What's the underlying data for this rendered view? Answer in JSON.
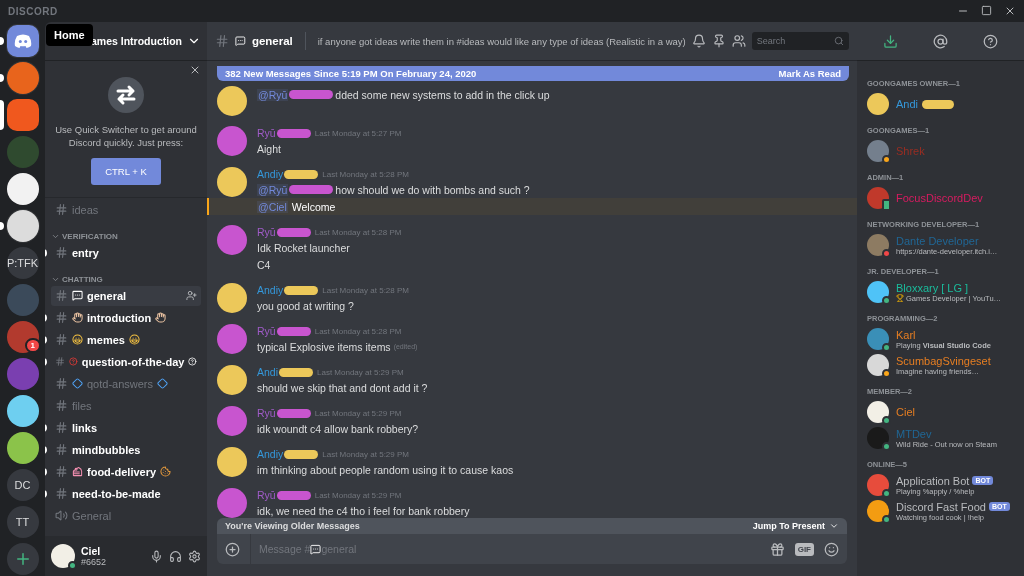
{
  "app_title": "DISCORD",
  "tooltip": "Home",
  "servers": [
    {
      "kind": "home",
      "selected": false,
      "unread": true
    },
    {
      "kind": "image",
      "color": "#e8641c",
      "selected": false,
      "unread": true
    },
    {
      "kind": "image",
      "color": "#f0581e",
      "selected": true,
      "unread": false
    },
    {
      "kind": "image",
      "color": "#2f4a2f",
      "selected": false,
      "unread": false
    },
    {
      "kind": "image",
      "color": "#f2f2f2",
      "selected": false,
      "unread": false
    },
    {
      "kind": "image",
      "color": "#dcdcdc",
      "selected": false,
      "unread": true
    },
    {
      "kind": "text",
      "label": "P:TFK",
      "selected": false,
      "unread": false
    },
    {
      "kind": "image",
      "color": "#3b4a5a",
      "selected": false,
      "unread": false
    },
    {
      "kind": "image",
      "color": "#b23a2e",
      "selected": false,
      "unread": false,
      "badge": "1"
    },
    {
      "kind": "image",
      "color": "#7a3fb0",
      "selected": false,
      "unread": false
    },
    {
      "kind": "image",
      "color": "#6ecff0",
      "selected": false,
      "unread": false
    },
    {
      "kind": "image",
      "color": "#8bc34a",
      "selected": false,
      "unread": false
    },
    {
      "kind": "text",
      "label": "DC",
      "selected": false,
      "unread": false
    },
    {
      "kind": "text",
      "label": "TT",
      "selected": false,
      "unread": false
    },
    {
      "kind": "add"
    }
  ],
  "server_name": "ames Introduction",
  "quick_switcher": {
    "text": "Use Quick Switcher to get around Discord quickly. Just press:",
    "button": "CTRL + K"
  },
  "channel_sections": [
    {
      "channels": [
        {
          "name": "ideas",
          "kind": "text",
          "unread": false,
          "selected": false
        }
      ]
    },
    {
      "category": "VERIFICATION",
      "expanded": true,
      "channels": [
        {
          "name": "entry",
          "kind": "text",
          "unread": true,
          "selected": false
        }
      ]
    },
    {
      "category": "CHATTING",
      "expanded": true,
      "channels": [
        {
          "name": "general",
          "kind": "text",
          "unread": false,
          "selected": true,
          "before": {
            "kind": "speech"
          }
        },
        {
          "name": "introduction",
          "kind": "text",
          "unread": true,
          "selected": false,
          "before": {
            "kind": "wave"
          },
          "after": {
            "kind": "wave"
          }
        },
        {
          "name": "memes",
          "kind": "text",
          "unread": true,
          "selected": false,
          "before": {
            "kind": "laugh"
          },
          "after": {
            "kind": "laugh"
          }
        },
        {
          "name": "question-of-the-day",
          "kind": "text",
          "unread": true,
          "selected": false,
          "before": {
            "kind": "question"
          },
          "after": {
            "kind": "question-outline"
          }
        },
        {
          "name": "qotd-answers",
          "kind": "text",
          "unread": false,
          "selected": false,
          "before": {
            "kind": "diamond"
          },
          "after": {
            "kind": "diamond"
          }
        },
        {
          "name": "files",
          "kind": "text",
          "unread": false,
          "selected": false
        },
        {
          "name": "links",
          "kind": "text",
          "unread": true,
          "selected": false
        },
        {
          "name": "mindbubbles",
          "kind": "text",
          "unread": true,
          "selected": false
        },
        {
          "name": "food-delivery",
          "kind": "text",
          "unread": true,
          "selected": false,
          "before": {
            "kind": "cupcake"
          },
          "after": {
            "kind": "donut"
          }
        },
        {
          "name": "need-to-be-made",
          "kind": "text",
          "unread": true,
          "selected": false
        },
        {
          "name": "General",
          "kind": "voice",
          "unread": false,
          "selected": false
        }
      ]
    }
  ],
  "user": {
    "name": "Ciel",
    "tag": "#6652"
  },
  "chat": {
    "channel": "general",
    "topic": "if anyone got ideas write them in #ideas would like any type of ideas (Realistic in a way)",
    "search_placeholder": "Search"
  },
  "new_messages": {
    "text": "382 New Messages Since 5:19 PM On February 24, 2020",
    "action": "Mark As Read"
  },
  "messages": [
    {
      "avatar": {
        "color": "#ecc85a"
      },
      "lines": [
        {
          "mention": "@Ryū",
          "redacted": true,
          "text": "dded some new systems to add in the click up",
          "highlighted": false
        }
      ]
    },
    {
      "author": {
        "name": "Ryū",
        "color": "#a05bc8"
      },
      "avatar": {
        "color": "#c855cf"
      },
      "timestamp": "Last Monday at 5:27 PM",
      "lines": [
        {
          "text": "Aight",
          "highlighted": false
        }
      ]
    },
    {
      "author": {
        "name": "Andiy",
        "color": "#3498db"
      },
      "avatar": {
        "color": "#ecc85a"
      },
      "timestamp": "Last Monday at 5:28 PM",
      "lines": [
        {
          "mention": "@Ryū",
          "redacted": true,
          "text": "how should we do with bombs and such ?",
          "highlighted": false
        },
        {
          "mention": "@Ciel",
          "redacted": false,
          "text": "Welcome",
          "highlighted": true
        }
      ]
    },
    {
      "author": {
        "name": "Ryū",
        "color": "#a05bc8"
      },
      "avatar": {
        "color": "#c855cf"
      },
      "timestamp": "Last Monday at 5:28 PM",
      "lines": [
        {
          "text": "Idk Rocket launcher",
          "highlighted": false
        },
        {
          "text": "C4",
          "highlighted": false
        }
      ]
    },
    {
      "author": {
        "name": "Andiy",
        "color": "#3498db"
      },
      "avatar": {
        "color": "#ecc85a"
      },
      "timestamp": "Last Monday at 5:28 PM",
      "lines": [
        {
          "text": "you good at writing ?",
          "highlighted": false
        }
      ]
    },
    {
      "author": {
        "name": "Ryū",
        "color": "#a05bc8"
      },
      "avatar": {
        "color": "#c855cf"
      },
      "timestamp": "Last Monday at 5:28 PM",
      "lines": [
        {
          "text": "typical Explosive items items",
          "edited": "(edited)",
          "highlighted": false
        }
      ]
    },
    {
      "author": {
        "name": "Andi",
        "color": "#3498db"
      },
      "avatar": {
        "color": "#ecc85a"
      },
      "timestamp": "Last Monday at 5:29 PM",
      "lines": [
        {
          "text": "should we skip that and dont add it ?",
          "highlighted": false
        }
      ]
    },
    {
      "author": {
        "name": "Ryū",
        "color": "#a05bc8"
      },
      "avatar": {
        "color": "#c855cf"
      },
      "timestamp": "Last Monday at 5:29 PM",
      "lines": [
        {
          "text": "idk woundt c4 allow bank robbery?",
          "highlighted": false
        }
      ]
    },
    {
      "author": {
        "name": "Andiy",
        "color": "#3498db"
      },
      "avatar": {
        "color": "#ecc85a"
      },
      "timestamp": "Last Monday at 5:29 PM",
      "lines": [
        {
          "text": "im thinking about people random using it to cause kaos",
          "highlighted": false
        }
      ]
    },
    {
      "author": {
        "name": "Ryū",
        "color": "#a05bc8"
      },
      "avatar": {
        "color": "#c855cf"
      },
      "timestamp": "Last Monday at 5:29 PM",
      "lines": [
        {
          "text": "idk, we need the c4 tho i feel for bank robbery",
          "highlighted": false
        }
      ]
    }
  ],
  "older_bar": {
    "text": "You're Viewing Older Messages",
    "action": "Jump To Present"
  },
  "composer": {
    "placeholder_prefix": "Message #",
    "placeholder_channel": "general",
    "gif": "GIF"
  },
  "member_groups": [
    {
      "title": "GOONGAMES OWNER—1",
      "members": [
        {
          "name": "Andi",
          "redacted": true,
          "color": "#3498db",
          "avatar": {
            "color": "#ecc85a"
          }
        }
      ]
    },
    {
      "title": "GOONGAMES—1",
      "members": [
        {
          "name": "Shrek",
          "color": "#992d22",
          "avatar": {
            "color": "#747f8d"
          },
          "status": {
            "kind": "idle"
          }
        }
      ]
    },
    {
      "title": "ADMIN—1",
      "members": [
        {
          "name": "FocusDiscordDev",
          "color": "#d81b60",
          "avatar": {
            "color": "#c0392b"
          },
          "status": {
            "kind": "mobile"
          }
        }
      ]
    },
    {
      "title": "NETWORKING DEVELOPER—1",
      "members": [
        {
          "name": "Dante Developer",
          "color": "#206694",
          "avatar": {
            "color": "#8d7b62"
          },
          "status": {
            "kind": "dnd"
          },
          "activity": "https://dante-developer.itch.i…"
        }
      ]
    },
    {
      "title": "JR. DEVELOPER—1",
      "members": [
        {
          "name": "Bloxxary [ LG ]",
          "color": "#1abc9c",
          "avatar": {
            "color": "#4fc3f7"
          },
          "status": {
            "kind": "online"
          },
          "activity": "Games Developer | YouTu…",
          "activity_icon": {
            "kind": "trophy"
          }
        }
      ]
    },
    {
      "title": "PROGRAMMING—2",
      "members": [
        {
          "name": "Karl",
          "color": "#e67e22",
          "avatar": {
            "color": "#3a8fb7"
          },
          "status": {
            "kind": "online"
          },
          "activity": "Playing **Visual Studio Code**"
        },
        {
          "name": "ScumbagSvingeset",
          "color": "#e67e22",
          "avatar": {
            "color": "#d8d8d8"
          },
          "status": {
            "kind": "idle"
          },
          "activity": "Imagine having friends…"
        }
      ]
    },
    {
      "title": "MEMBER—2",
      "members": [
        {
          "name": "Ciel",
          "color": "#e67e22",
          "avatar": {
            "color": "#f2efe6"
          },
          "status": {
            "kind": "online"
          }
        },
        {
          "name": "MTDev",
          "color": "#206694",
          "avatar": {
            "color": "#1a1a1a"
          },
          "status": {
            "kind": "online"
          },
          "activity": "Wild Ride - Out now on Steam"
        }
      ]
    },
    {
      "title": "ONLINE—5",
      "members": [
        {
          "name": "Application Bot",
          "color": "#b9bbbe",
          "avatar": {
            "color": "#e74c3c"
          },
          "status": {
            "kind": "online"
          },
          "bot": "BOT",
          "activity": "Playing %apply / %help"
        },
        {
          "name": "Discord Fast Food",
          "color": "#b9bbbe",
          "avatar": {
            "color": "#f39c12"
          },
          "status": {
            "kind": "online"
          },
          "bot": "BOT",
          "activity": "Watching food cook | !help"
        }
      ]
    }
  ]
}
